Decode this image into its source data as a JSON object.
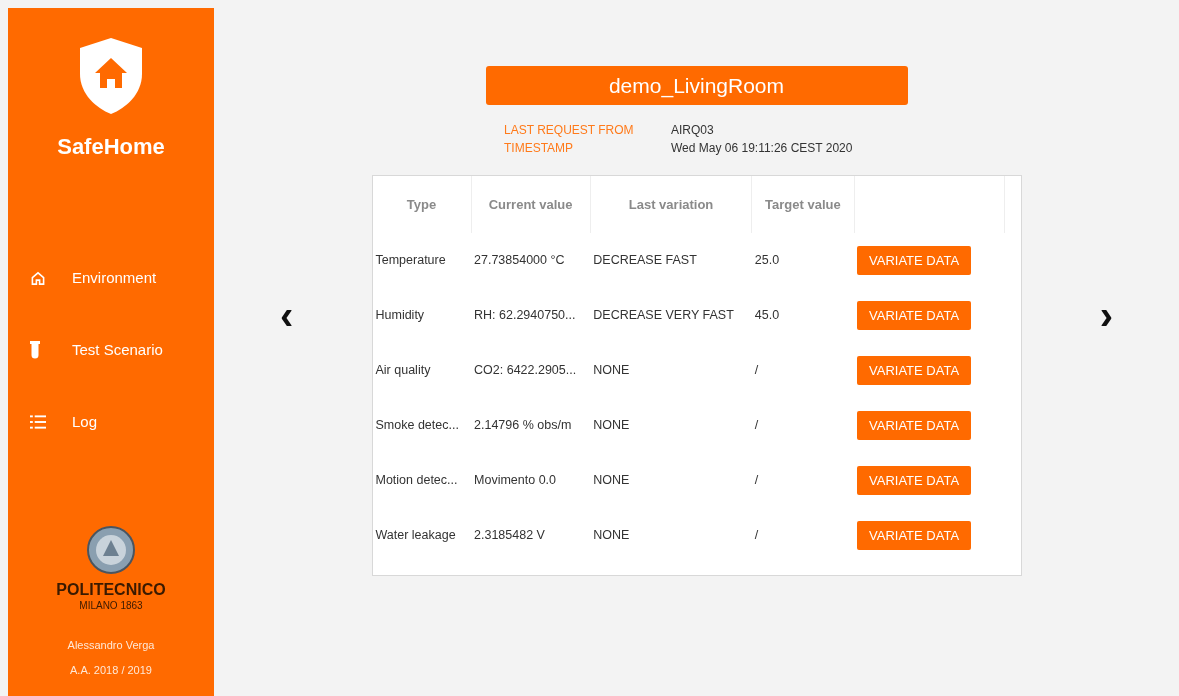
{
  "sidebar": {
    "brand": "SafeHome",
    "items": [
      {
        "kind": "home",
        "label": "Environment"
      },
      {
        "kind": "tube",
        "label": "Test Scenario"
      },
      {
        "kind": "list",
        "label": "Log"
      }
    ],
    "footer": {
      "university": "POLITECNICO",
      "city": "MILANO 1863",
      "author": "Alessandro Verga",
      "year": "A.A. 2018 / 2019"
    }
  },
  "room": {
    "title": "demo_LivingRoom",
    "info": [
      {
        "label": "LAST REQUEST FROM",
        "value": "AIRQ03"
      },
      {
        "label": "TIMESTAMP",
        "value": "Wed May 06 19:11:26 CEST 2020"
      }
    ]
  },
  "nav": {
    "prev": "‹",
    "next": "›"
  },
  "table": {
    "columns": [
      "Type",
      "Current value",
      "Last variation",
      "Target value"
    ],
    "rows": [
      {
        "type": "Temperature",
        "current": "27.73854000 °C",
        "variation": "DECREASE FAST",
        "target": "25.0",
        "action": "VARIATE DATA"
      },
      {
        "type": "Humidity",
        "current": "RH: 62.2940750...",
        "variation": "DECREASE VERY FAST",
        "target": "45.0",
        "action": "VARIATE DATA"
      },
      {
        "type": "Air quality",
        "current": "CO2: 6422.2905...",
        "variation": "NONE",
        "target": "/",
        "action": "VARIATE DATA"
      },
      {
        "type": "Smoke detec...",
        "current": "2.14796 % obs/m",
        "variation": "NONE",
        "target": "/",
        "action": "VARIATE DATA"
      },
      {
        "type": "Motion detec...",
        "current": "Movimento 0.0",
        "variation": "NONE",
        "target": "/",
        "action": "VARIATE DATA"
      },
      {
        "type": "Water leakage",
        "current": "2.3185482 V",
        "variation": "NONE",
        "target": "/",
        "action": "VARIATE DATA"
      }
    ]
  }
}
